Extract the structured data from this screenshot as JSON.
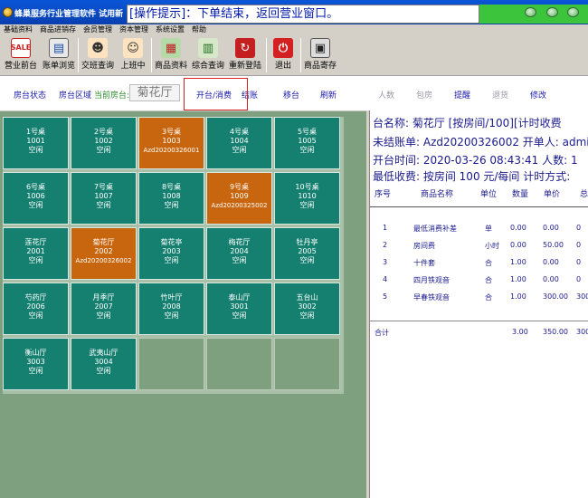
{
  "window": {
    "title": "蜂巢服务行业管理软件  试用新",
    "tip": "[操作提示]：下单结束，返回营业窗口。"
  },
  "menu": [
    "基础资料",
    "商品进销存",
    "会员管理",
    "资本管理",
    "系统设置",
    "帮助"
  ],
  "toolbar": [
    {
      "label": "营业前台",
      "icon": "sale-sign-icon"
    },
    {
      "label": "账单浏览",
      "icon": "bill-list-icon"
    },
    {
      "label": "交班查询",
      "icon": "shift-query-icon"
    },
    {
      "label": "上班中",
      "icon": "on-duty-icon"
    },
    {
      "label": "商品资料",
      "icon": "product-data-icon"
    },
    {
      "label": "综合查询",
      "icon": "chart-query-icon"
    },
    {
      "label": "重新登陆",
      "icon": "relogin-icon"
    },
    {
      "label": "退出",
      "icon": "power-icon"
    },
    {
      "label": "商品寄存",
      "icon": "cash-register-icon"
    }
  ],
  "actions": {
    "room_status": "房台状态",
    "room_area": "房台区域",
    "current_label": "当前房台:",
    "current_value": "菊花厅",
    "open_consume": "开台/消费",
    "checkout": "结账",
    "move": "移台",
    "refresh": "刷新",
    "people": "人数",
    "box": "包房",
    "remind": "提醒",
    "return": "退货",
    "modify": "修改"
  },
  "rooms": [
    {
      "name": "1号桌",
      "code": "1001",
      "status": "空闲",
      "busy": false
    },
    {
      "name": "2号桌",
      "code": "1002",
      "status": "空闲",
      "busy": false
    },
    {
      "name": "3号桌",
      "code": "1003",
      "status": "Azd20200326001",
      "busy": true
    },
    {
      "name": "4号桌",
      "code": "1004",
      "status": "空闲",
      "busy": false
    },
    {
      "name": "5号桌",
      "code": "1005",
      "status": "空闲",
      "busy": false
    },
    {
      "name": "6号桌",
      "code": "1006",
      "status": "空闲",
      "busy": false
    },
    {
      "name": "7号桌",
      "code": "1007",
      "status": "空闲",
      "busy": false
    },
    {
      "name": "8号桌",
      "code": "1008",
      "status": "空闲",
      "busy": false
    },
    {
      "name": "9号桌",
      "code": "1009",
      "status": "Azd20200325002",
      "busy": true
    },
    {
      "name": "10号桌",
      "code": "1010",
      "status": "空闲",
      "busy": false
    },
    {
      "name": "莲花厅",
      "code": "2001",
      "status": "空闲",
      "busy": false
    },
    {
      "name": "菊花厅",
      "code": "2002",
      "status": "Azd20200326002",
      "busy": true
    },
    {
      "name": "菊花亭",
      "code": "2003",
      "status": "空闲",
      "busy": false
    },
    {
      "name": "梅花厅",
      "code": "2004",
      "status": "空闲",
      "busy": false
    },
    {
      "name": "牡丹亭",
      "code": "2005",
      "status": "空闲",
      "busy": false
    },
    {
      "name": "芍药厅",
      "code": "2006",
      "status": "空闲",
      "busy": false
    },
    {
      "name": "月季厅",
      "code": "2007",
      "status": "空闲",
      "busy": false
    },
    {
      "name": "竹叶厅",
      "code": "2008",
      "status": "空闲",
      "busy": false
    },
    {
      "name": "泰山厅",
      "code": "3001",
      "status": "空闲",
      "busy": false
    },
    {
      "name": "五台山",
      "code": "3002",
      "status": "空闲",
      "busy": false
    },
    {
      "name": "衡山厅",
      "code": "3003",
      "status": "空闲",
      "busy": false
    },
    {
      "name": "武夷山厅",
      "code": "3004",
      "status": "空闲",
      "busy": false
    }
  ],
  "detail": {
    "room_line": "台名称: 菊花厅 [按房间/100][计时收费",
    "bill_line": "未结账单: Azd20200326002   开单人: admin",
    "open_line": "开台时间: 2020-03-26 08:43:41   人数: 1",
    "min_line": "最低收费: 按房间 100 元/每间     计时方式:",
    "headers": [
      "序号",
      "商品名称",
      "单位",
      "数量",
      "单价",
      "总"
    ],
    "rows": [
      {
        "no": "1",
        "name": "最低消费补差",
        "unit": "单",
        "qty": "0.00",
        "price": "0.00",
        "total": "0"
      },
      {
        "no": "2",
        "name": "房间费",
        "unit": "小时",
        "qty": "0.00",
        "price": "50.00",
        "total": "0"
      },
      {
        "no": "3",
        "name": "十件套",
        "unit": "合",
        "qty": "1.00",
        "price": "0.00",
        "total": "0"
      },
      {
        "no": "4",
        "name": "四月铁观音",
        "unit": "合",
        "qty": "1.00",
        "price": "0.00",
        "total": "0"
      },
      {
        "no": "5",
        "name": "早春铁观音",
        "unit": "合",
        "qty": "1.00",
        "price": "300.00",
        "total": "300"
      }
    ],
    "total": {
      "label": "合计",
      "qty": "3.00",
      "price": "350.00",
      "total": "300"
    }
  }
}
